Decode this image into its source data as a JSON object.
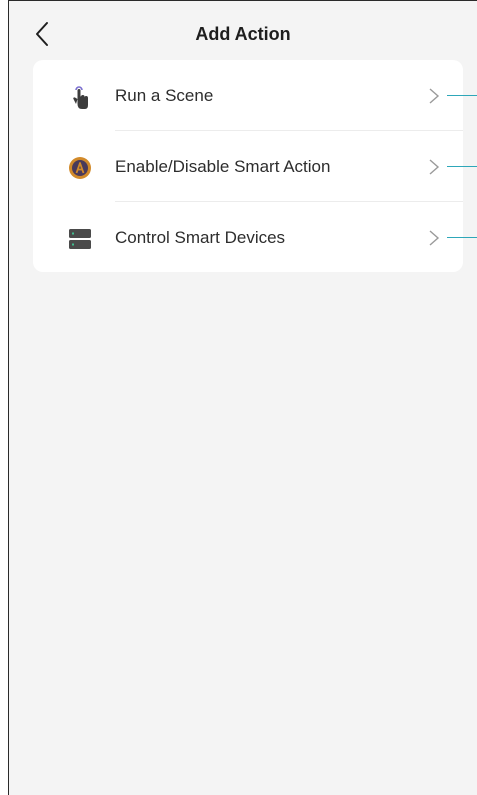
{
  "header": {
    "title": "Add Action",
    "back_icon": "chevron-left-icon"
  },
  "actions": [
    {
      "label": "Run a Scene",
      "icon": "tap-hand-icon",
      "icon_color": "#3c3c3c",
      "accent": "#7b6fd0"
    },
    {
      "label": "Enable/Disable Smart Action",
      "icon": "smart-action-a-icon",
      "icon_color": "#d28a2a",
      "accent": "#4a3a5a"
    },
    {
      "label": "Control Smart Devices",
      "icon": "device-stack-icon",
      "icon_color": "#4a4a4a",
      "accent": "#3fbf8f"
    }
  ],
  "colors": {
    "background": "#f4f4f4",
    "card": "#ffffff",
    "connector": "#2ea7b9",
    "chevron": "#9a9a9a"
  }
}
